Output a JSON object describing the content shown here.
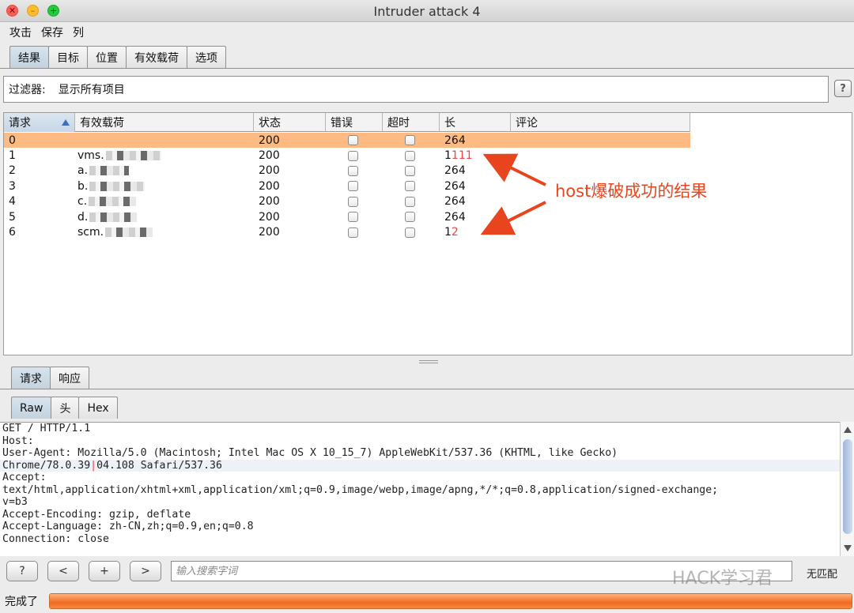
{
  "window": {
    "title": "Intruder attack 4"
  },
  "menu": [
    "攻击",
    "保存",
    "列"
  ],
  "main_tabs": [
    {
      "label": "结果",
      "active": true
    },
    {
      "label": "目标",
      "active": false
    },
    {
      "label": "位置",
      "active": false
    },
    {
      "label": "有效载荷",
      "active": false
    },
    {
      "label": "选项",
      "active": false
    }
  ],
  "filter": {
    "label": "过滤器:",
    "value": "显示所有项目"
  },
  "help_label": "?",
  "table": {
    "columns": [
      "请求",
      "有效载荷",
      "状态",
      "错误",
      "超时",
      "长",
      "评论"
    ],
    "sorted_column": "请求",
    "rows": [
      {
        "request": "0",
        "payload": "",
        "status": "200",
        "error": false,
        "timeout": false,
        "length": "264",
        "comment": "",
        "selected": true
      },
      {
        "request": "1",
        "payload": "vms.",
        "status": "200",
        "error": false,
        "timeout": false,
        "length": "1",
        "length_tail": "111",
        "comment": "",
        "selected": false
      },
      {
        "request": "2",
        "payload": "a.",
        "status": "200",
        "error": false,
        "timeout": false,
        "length": "264",
        "comment": "",
        "selected": false
      },
      {
        "request": "3",
        "payload": "b.",
        "status": "200",
        "error": false,
        "timeout": false,
        "length": "264",
        "comment": "",
        "selected": false
      },
      {
        "request": "4",
        "payload": "c.",
        "status": "200",
        "error": false,
        "timeout": false,
        "length": "264",
        "comment": "",
        "selected": false
      },
      {
        "request": "5",
        "payload": "d.",
        "status": "200",
        "error": false,
        "timeout": false,
        "length": "264",
        "comment": "",
        "selected": false
      },
      {
        "request": "6",
        "payload": "scm.",
        "status": "200",
        "error": false,
        "timeout": false,
        "length": "1",
        "length_tail": "2",
        "comment": "",
        "selected": false
      }
    ]
  },
  "annotation": {
    "text": "host爆破成功的结果",
    "color": "#e8451e"
  },
  "detail_tabs": [
    {
      "label": "请求",
      "active": true
    },
    {
      "label": "响应",
      "active": false
    }
  ],
  "view_tabs": [
    {
      "label": "Raw",
      "active": true
    },
    {
      "label": "头",
      "active": false
    },
    {
      "label": "Hex",
      "active": false
    }
  ],
  "raw_lines": [
    "GET / HTTP/1.1",
    "Host:",
    "User-Agent: Mozilla/5.0 (Macintosh; Intel Mac OS X 10_15_7) AppleWebKit/537.36 (KHTML, like Gecko)",
    "Chrome/78.0.3904.108 Safari/537.36",
    "Accept:",
    "text/html,application/xhtml+xml,application/xml;q=0.9,image/webp,image/apng,*/*;q=0.8,application/signed-exchange;",
    "v=b3",
    "Accept-Encoding: gzip, deflate",
    "Accept-Language: zh-CN,zh;q=0.9,en;q=0.8",
    "Connection: close"
  ],
  "raw_line3_parts": [
    "Chrome/78.0.39",
    "0",
    "4.108 Safari/537.36"
  ],
  "bottom": {
    "help": "?",
    "prev": "<",
    "add": "+",
    "next": ">",
    "search_placeholder": "输入搜索字词",
    "match_label": "无匹配",
    "watermark": "HACK学习君"
  },
  "status": {
    "text": "完成了",
    "progress": 1.0,
    "progress_color": "#f06a22"
  }
}
